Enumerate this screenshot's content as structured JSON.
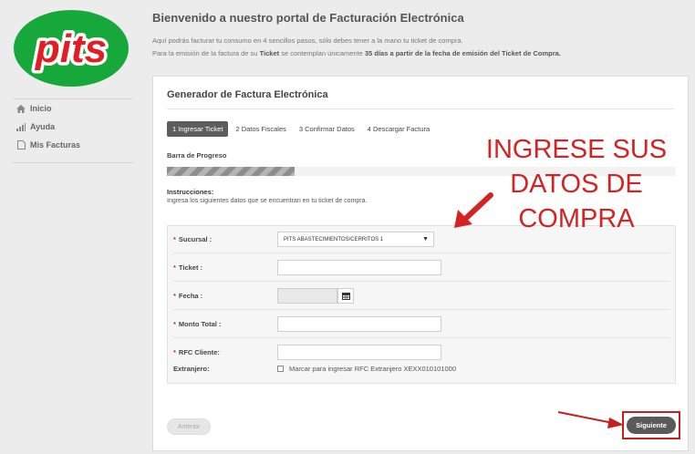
{
  "brand": {
    "logo_text": "pits",
    "logo_colors": {
      "green": "#17a83b",
      "red": "#e21d24",
      "white": "#ffffff"
    }
  },
  "sidebar": {
    "items": [
      {
        "label": "Inicio",
        "icon": "home-icon"
      },
      {
        "label": "Ayuda",
        "icon": "bar-chart-icon"
      },
      {
        "label": "Mis Facturas",
        "icon": "file-icon"
      }
    ]
  },
  "header": {
    "title": "Bienvenido a nuestro portal de Facturación Electrónica",
    "intro_line1": "Aquí podrás facturar tu consumo en 4 sencillos pasos, sólo debes tener a la mano tu ticket de compra.",
    "intro_line2_a": "Para la emisión de la factura de su ",
    "intro_line2_b": "Ticket",
    "intro_line2_c": " se contemplan únicamente ",
    "intro_line2_d": "35 días a partir de la fecha de emisión del Ticket de Compra."
  },
  "card": {
    "title": "Generador de Factura Electrónica",
    "steps": [
      {
        "label": "1 Ingresar Ticket",
        "active": true
      },
      {
        "label": "2 Datos Fiscales",
        "active": false
      },
      {
        "label": "3 Confirmar Datos",
        "active": false
      },
      {
        "label": "4 Descargar Factura",
        "active": false
      }
    ],
    "progress_label": "Barra de Progreso",
    "progress": 0.25,
    "instructions_title": "Instrucciones:",
    "instructions_text": "Ingresa los siguientes datos que se encuentran en tu ticket de compra."
  },
  "form": {
    "sucursal": {
      "label": "Sucursal :",
      "value": "PITS ABASTECIMIENTOS/CERRITOS 1"
    },
    "ticket": {
      "label": "Ticket :",
      "value": ""
    },
    "fecha": {
      "label": "Fecha :",
      "value": ""
    },
    "monto": {
      "label": "Monto Total :",
      "value": ""
    },
    "rfc": {
      "label": "RFC Cliente:",
      "value": ""
    },
    "extranjero": {
      "label": "Extranjero:",
      "checkbox_label": "Marcar para ingresar RFC Extranjero XEXX010101000"
    },
    "required_mark": "*"
  },
  "buttons": {
    "prev": "Anterior",
    "next": "Siguiente"
  },
  "annotation": {
    "line1": "INGRESE SUS",
    "line2": "DATOS DE",
    "line3": "COMPRA",
    "color": "#d42323"
  }
}
